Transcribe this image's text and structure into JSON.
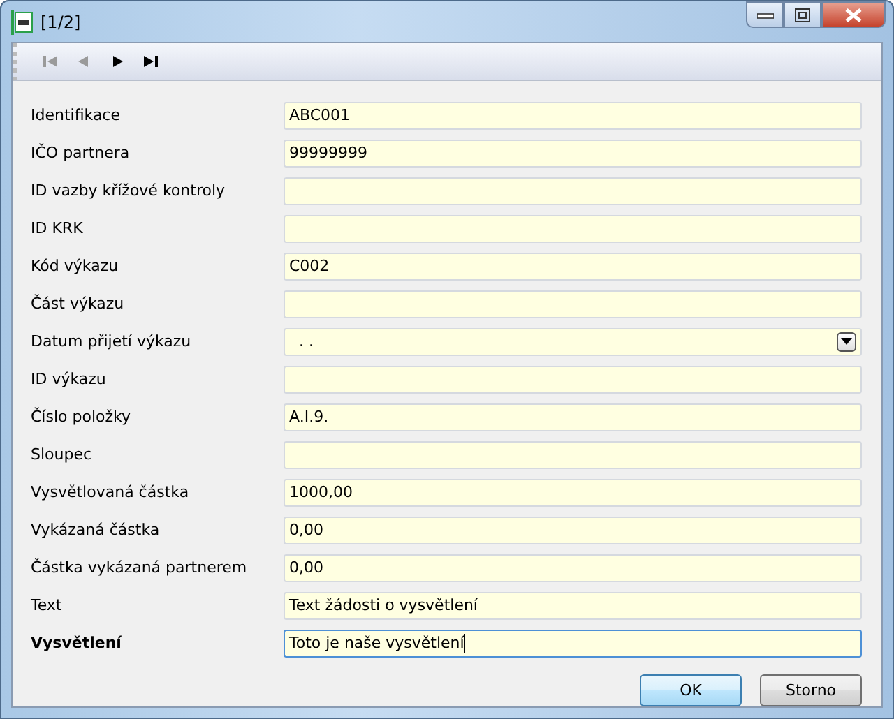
{
  "window": {
    "title": "[1/2]"
  },
  "toolbar": [
    {
      "kind": "first",
      "disabled": true
    },
    {
      "kind": "prev",
      "disabled": true
    },
    {
      "kind": "next",
      "disabled": false
    },
    {
      "kind": "last",
      "disabled": false
    }
  ],
  "fields": [
    {
      "label": "Identifikace",
      "value": "ABC001",
      "kind": "text",
      "focused": false
    },
    {
      "label": "IČO partnera",
      "value": "99999999",
      "kind": "text",
      "focused": false
    },
    {
      "label": "ID vazby křížové kontroly",
      "kind": "text",
      "focused": false
    },
    {
      "label": "ID KRK",
      "kind": "text",
      "focused": false
    },
    {
      "label": "Kód výkazu",
      "value": "C002",
      "kind": "text",
      "focused": false
    },
    {
      "label": "Část výkazu",
      "kind": "text",
      "focused": false
    },
    {
      "label": "Datum přijetí výkazu",
      "value": ". .",
      "kind": "date",
      "focused": false
    },
    {
      "label": "ID výkazu",
      "kind": "text",
      "focused": false
    },
    {
      "label": "Číslo položky",
      "value": "A.I.9.",
      "kind": "text",
      "focused": false
    },
    {
      "label": "Sloupec",
      "kind": "text",
      "focused": false
    },
    {
      "label": "Vysvětlovaná částka",
      "value": "1000,00",
      "kind": "text",
      "focused": false
    },
    {
      "label": "Vykázaná částka",
      "value": "0,00",
      "kind": "text",
      "focused": false
    },
    {
      "label": "Částka vykázaná partnerem",
      "value": "0,00",
      "kind": "text",
      "focused": false
    },
    {
      "label": "Text",
      "value": "Text žádosti o vysvětlení",
      "kind": "text",
      "focused": false
    },
    {
      "label": "Vysvětlení",
      "value": "Toto je naše vysvětlení",
      "kind": "text",
      "focused": true
    }
  ],
  "buttons": [
    {
      "label": "OK",
      "default": true
    },
    {
      "label": "Storno",
      "default": false
    }
  ]
}
